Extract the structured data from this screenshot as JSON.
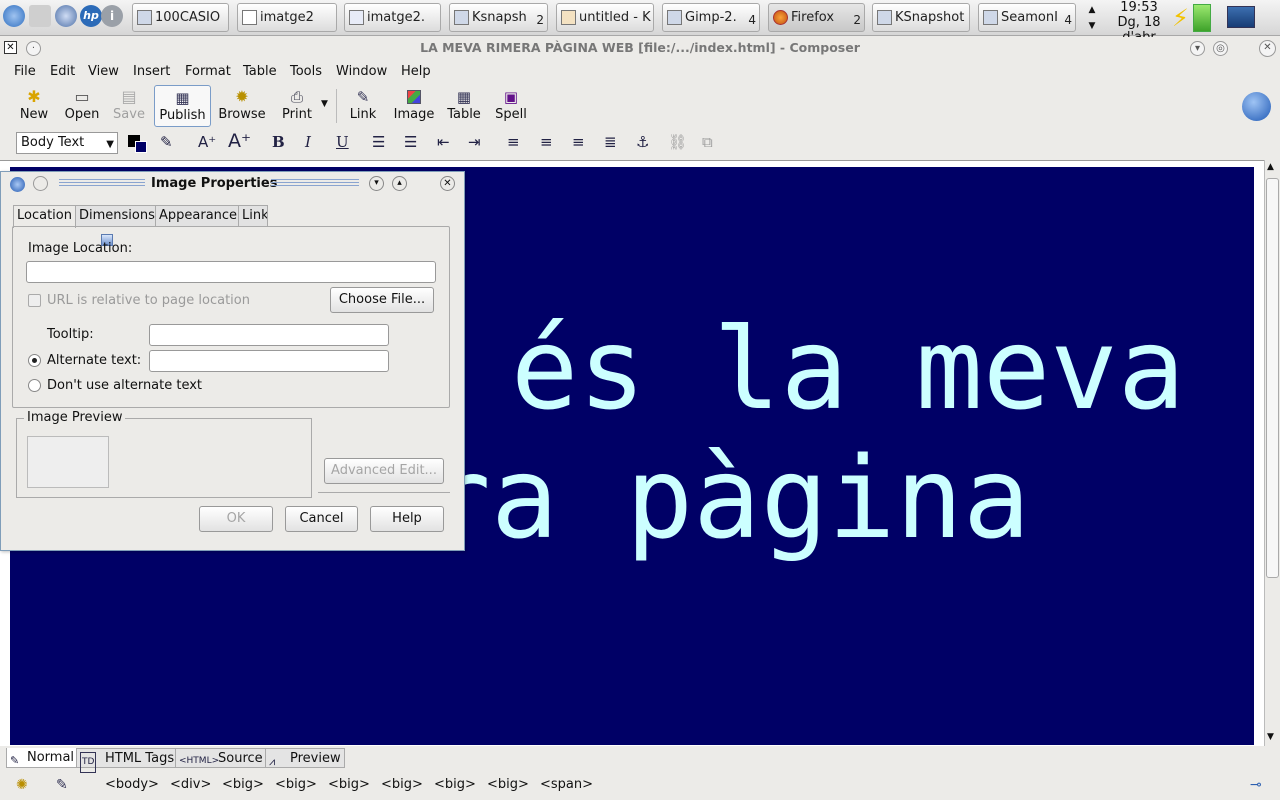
{
  "taskbar": {
    "items": [
      {
        "label": "100CASIO",
        "count": ""
      },
      {
        "label": "imatge2",
        "count": ""
      },
      {
        "label": "imatge2.",
        "count": ""
      },
      {
        "label": "Ksnapsh",
        "count": "2"
      },
      {
        "label": "untitled - K",
        "count": ""
      },
      {
        "label": "Gimp-2.",
        "count": "4"
      },
      {
        "label": "Firefox",
        "count": "2"
      },
      {
        "label": "KSnapshot",
        "count": ""
      },
      {
        "label": "SeamonI",
        "count": "4"
      }
    ],
    "clock_time": "19:53",
    "clock_date": "Dg, 18 d'abr"
  },
  "window": {
    "title": "LA MEVA RIMERA PÀGINA WEB [file:/.../index.html] - Composer"
  },
  "menu": [
    "File",
    "Edit",
    "View",
    "Insert",
    "Format",
    "Table",
    "Tools",
    "Window",
    "Help"
  ],
  "toolbar": {
    "new": "New",
    "open": "Open",
    "save": "Save",
    "publish": "Publish",
    "browse": "Browse",
    "print": "Print",
    "link": "Link",
    "image": "Image",
    "table": "Table",
    "spell": "Spell"
  },
  "format": {
    "paragraph_style": "Body Text",
    "bold": "B",
    "italic": "I",
    "underline": "U"
  },
  "document": {
    "line1": "a és la meva",
    "line2": "era pàgina",
    "background": "#000066",
    "text_color": "#ccffff"
  },
  "mode_tabs": [
    "Normal",
    "HTML Tags",
    "Source",
    "Preview"
  ],
  "status_tags": [
    "<body>",
    "<div>",
    "<big>",
    "<big>",
    "<big>",
    "<big>",
    "<big>",
    "<big>",
    "<span>"
  ],
  "dialog": {
    "title": "Image Properties",
    "tabs": [
      "Location",
      "Dimensions",
      "Appearance",
      "Link"
    ],
    "image_location_label": "Image Location:",
    "image_location_value": "",
    "relative_url_label": "URL is relative to page location",
    "choose_file": "Choose File...",
    "tooltip_label": "Tooltip:",
    "tooltip_value": "",
    "alt_text_label": "Alternate text:",
    "alt_text_value": "",
    "no_alt_label": "Don't use alternate text",
    "preview_label": "Image Preview",
    "advanced_edit": "Advanced Edit...",
    "ok": "OK",
    "cancel": "Cancel",
    "help": "Help"
  }
}
